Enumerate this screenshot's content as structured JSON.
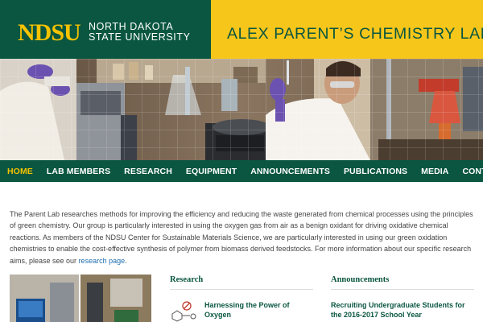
{
  "brand": {
    "logo_mark": "NDSU",
    "university_line1": "NORTH DAKOTA",
    "university_line2": "STATE UNIVERSITY"
  },
  "lab_title": "ALEX PARENT’S CHEMISTRY LAB",
  "nav": {
    "items": [
      "HOME",
      "LAB MEMBERS",
      "RESEARCH",
      "EQUIPMENT",
      "ANNOUNCEMENTS",
      "PUBLICATIONS",
      "MEDIA",
      "CONTACT"
    ],
    "active": "HOME"
  },
  "intro": {
    "text": "The Parent Lab researches methods for improving the efficiency and reducing the waste generated from chemical processes using the principles of green chemistry. Our group is particularly interested in using the oxygen gas from air as a benign oxidant for driving oxidative chemical reactions. As members of the NDSU Center for Sustainable Materials Science, we are particularly interested in using our green oxidation chemistries to enable the cost-effective synthesis of polymer from biomass derived feedstocks. For more information about our specific research aims, please see our",
    "link_text": "research page",
    "end": "."
  },
  "research": {
    "heading": "Research",
    "post_title_line1": "Harnessing the Power of",
    "post_title_line2": "Oxygen"
  },
  "announcements": {
    "heading": "Announcements",
    "post_title_line1": "Recruiting Undergraduate Students for",
    "post_title_line2": "the 2016-2017 School Year"
  },
  "colors": {
    "ndsu_green": "#0a5640",
    "ndsu_yellow": "#f7c61a",
    "link_blue": "#1f6fb2"
  }
}
